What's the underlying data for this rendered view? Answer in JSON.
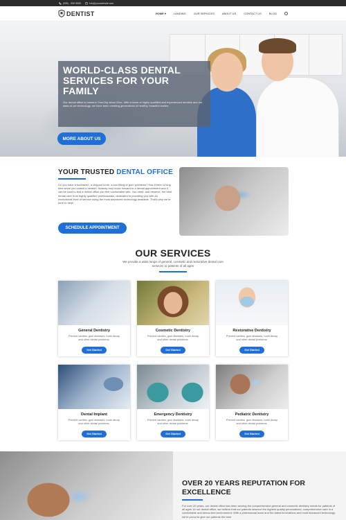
{
  "topbar": {
    "phone": "(555) - 555 5555",
    "email": "info@yourwebsite.com"
  },
  "brand": {
    "name": "DENTIST"
  },
  "nav": {
    "items": [
      "HOME",
      "LANDING",
      "OUR SERVICES",
      "ABOUT US",
      "CONTACT US",
      "BLOG"
    ]
  },
  "hero": {
    "title": "WORLD-CLASS DENTAL SERVICES FOR YOUR FAMILY",
    "text": "Our dental office is based in YourCity since 20xx. With a team of highly qualified and experienced dentists and our state-of-art technology, we have been creating generations of healthy, beautiful smiles.",
    "button": "MORE ABOUT US"
  },
  "about": {
    "title": "YOUR TRUSTED",
    "title_hl": "DENTAL OFFICE",
    "text": "Do you have a toothache, a chipped tooth, a lost filling or gum problems? Has it been a long time since you visited a dentist? Nobody truly looks forward to a dental appointment and it can be hard to find a dental office you feel comfortable with. You need, and deserve, the best dental care from highly qualified professionals, dedicated to providing you with an exceptional level of service using the most advanced technology available. That's why we're here to help!",
    "button": "SCHEDULE APPOINTMENT"
  },
  "services": {
    "title": "OUR SERVICES",
    "subtitle": "We provide a wide range of general, cosmetic and restorative dental care services to patients of all ages",
    "items": [
      {
        "name": "General Dentistry",
        "desc": "Prevent cavities, gum diseases, tooth decay and other dental problems.",
        "button": "Get Started"
      },
      {
        "name": "Cosmetic Dentistry",
        "desc": "Prevent cavities, gum diseases, tooth decay and other dental problems.",
        "button": "Get Started"
      },
      {
        "name": "Restorative Dentistry",
        "desc": "Prevent cavities, gum diseases, tooth decay and other dental problems.",
        "button": "Get Started"
      },
      {
        "name": "Dental Implant",
        "desc": "Prevent cavities, gum diseases, tooth decay and other dental problems.",
        "button": "Get Started"
      },
      {
        "name": "Emergency Dentistry",
        "desc": "Prevent cavities, gum diseases, tooth decay and other dental problems.",
        "button": "Get Started"
      },
      {
        "name": "Pediatric Dentistry",
        "desc": "Prevent cavities, gum diseases, tooth decay and other dental problems.",
        "button": "Get Started"
      }
    ]
  },
  "reputation": {
    "title": "OVER 20 YEARS REPUTATION FOR EXCELLENCE",
    "text": "For over 20 years, our dental office has been serving the comprehensive general and cosmetic dentistry needs for patients of all ages. At our dental office, we believe that our patients deserve the highest quality personalized, comprehensive care in a comfortable and stress-free environment. With a professional team and the latest innovations and most advanced technology, we're proud to give our patients the best"
  },
  "colors": {
    "accent": "#1f6fd6",
    "dark": "#2b2b2b"
  }
}
